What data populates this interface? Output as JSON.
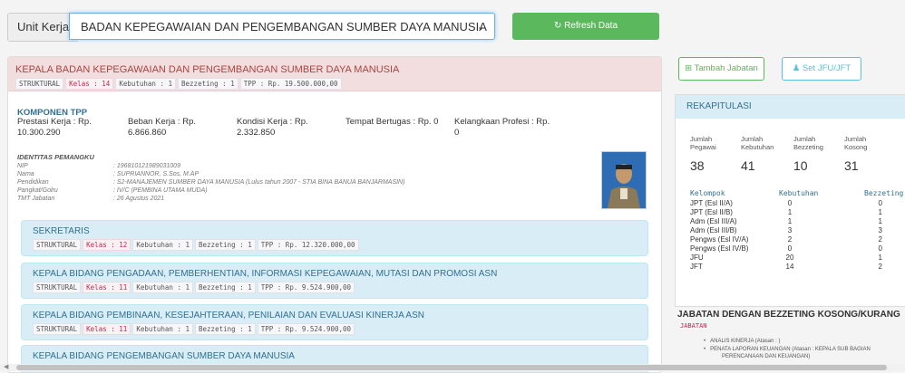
{
  "top": {
    "unit_label": "Unit Kerja",
    "unit_value": "BADAN KEPEGAWAIAN DAN PENGEMBANGAN SUMBER DAYA MANUSIA",
    "refresh_label": "↻ Refresh Data"
  },
  "main": {
    "title": "KEPALA BADAN KEPEGAWAIAN DAN PENGEMBANGAN SUMBER DAYA MANUSIA",
    "tags": {
      "type": "STRUKTURAL",
      "kelas": "Kelas : 14",
      "kebutuhan": "Kebutuhan : 1",
      "bezzeting": "Bezzeting : 1",
      "tpp": "TPP : Rp. 19.500.000,00"
    },
    "komponen_title": "KOMPONEN TPP",
    "komponen": [
      {
        "label": "Prestasi Kerja : Rp.",
        "value": "10.300.290"
      },
      {
        "label": "Beban Kerja : Rp.",
        "value": "6.866.860"
      },
      {
        "label": "Kondisi Kerja : Rp.",
        "value": "2.332.850"
      },
      {
        "label": "Tempat Bertugas : Rp. 0",
        "value": ""
      },
      {
        "label": "Kelangkaan Profesi : Rp.",
        "value": "0"
      }
    ],
    "identitas_title": "IDENTITAS PEMANGKU",
    "identitas": [
      {
        "k": "NIP",
        "v": ": 196810121989031009"
      },
      {
        "k": "Nama",
        "v": ": SUPRIANNOR, S.Sos, M.AP"
      },
      {
        "k": "Pendidikan",
        "v": ": S2-MANAJEMEN SUMBER DAYA MANUSIA (Lulus tahun 2007 - STIA BINA BANUA BANJARMASIN)"
      },
      {
        "k": "Pangkat/Golru",
        "v": ": IV/C (PEMBINA UTAMA MUDA)"
      },
      {
        "k": "TMT Jabatan",
        "v": ": 26 Agustus 2021"
      }
    ],
    "subs": [
      {
        "title": "SEKRETARIS",
        "type": "STRUKTURAL",
        "kelas": "Kelas : 12",
        "kebutuhan": "Kebutuhan : 1",
        "bezzeting": "Bezzeting : 1",
        "tpp": "TPP : Rp. 12.320.000,00"
      },
      {
        "title": "KEPALA BIDANG PENGADAAN, PEMBERHENTIAN, INFORMASI KEPEGAWAIAN, MUTASI DAN PROMOSI ASN",
        "type": "STRUKTURAL",
        "kelas": "Kelas : 11",
        "kebutuhan": "Kebutuhan : 1",
        "bezzeting": "Bezzeting : 1",
        "tpp": "TPP : Rp. 9.524.900,00"
      },
      {
        "title": "KEPALA BIDANG PEMBINAAN, KESEJAHTERAAN, PENILAIAN DAN EVALUASI KINERJA ASN",
        "type": "STRUKTURAL",
        "kelas": "Kelas : 11",
        "kebutuhan": "Kebutuhan : 1",
        "bezzeting": "Bezzeting : 1",
        "tpp": "TPP : Rp. 9.524.900,00"
      },
      {
        "title": "KEPALA BIDANG PENGEMBANGAN SUMBER DAYA MANUSIA"
      }
    ]
  },
  "right": {
    "tambah_label": "⊞ Tambah Jabatan",
    "set_label": "♟ Set JFU/JFT",
    "rekap_title": "REKAPITULASI",
    "stats": [
      {
        "l1": "Jumlah",
        "l2": "Pegawai",
        "v": "38"
      },
      {
        "l1": "Jumlah",
        "l2": "Kebutuhan",
        "v": "41"
      },
      {
        "l1": "Jumlah",
        "l2": "Bezzeting",
        "v": "10"
      },
      {
        "l1": "Jumlah",
        "l2": "Kosong",
        "v": "31"
      }
    ],
    "kel_headers": {
      "kelompok": "Kelompok",
      "kebutuhan": "Kebutuhan",
      "bezzeting": "Bezzeting"
    },
    "kelompok": [
      {
        "n": "JPT (Esl II/A)",
        "k": "0",
        "b": "0"
      },
      {
        "n": "JPT (Esl II/B)",
        "k": "1",
        "b": "1"
      },
      {
        "n": "Adm (Esl III/A)",
        "k": "1",
        "b": "1"
      },
      {
        "n": "Adm (Esl III/B)",
        "k": "3",
        "b": "3"
      },
      {
        "n": "Pengws (Esl IV/A)",
        "k": "2",
        "b": "2"
      },
      {
        "n": "Pengws (Esl IV/B)",
        "k": "0",
        "b": "0"
      },
      {
        "n": "JFU",
        "k": "20",
        "b": "1"
      },
      {
        "n": "JFT",
        "k": "14",
        "b": "2"
      }
    ],
    "bz_title": "JABATAN DENGAN BEZZETING KOSONG/KURANG",
    "bz_tag": "JABATAN",
    "bz_items": [
      "ANALIS KINERJA (Atasan : )",
      "PENATA LAPORAN KEUANGAN (Atasan : KEPALA SUB BAGIAN",
      "PERENCANAAN DAN KEUANGAN)"
    ]
  }
}
